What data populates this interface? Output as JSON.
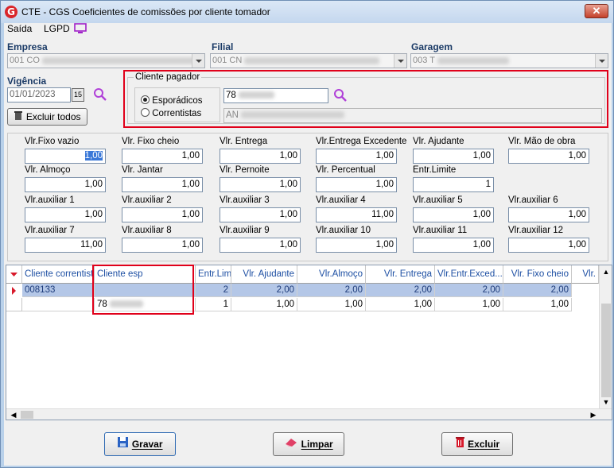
{
  "window": {
    "title": "CTE - CGS Coeficientes de comissões por cliente tomador",
    "icon": "app-logo-icon",
    "close": "✕"
  },
  "menu": {
    "saida": "Saída",
    "lgpd": "LGPD"
  },
  "empresa": {
    "label": "Empresa",
    "value": "001 CO"
  },
  "filial": {
    "label": "Filial",
    "value": "001 CN"
  },
  "garagem": {
    "label": "Garagem",
    "value": "003 T"
  },
  "vigencia": {
    "label": "Vigência",
    "value": "01/01/2023"
  },
  "excluir_todos": "Excluir todos",
  "cliente_pagador": {
    "legend": "Cliente pagador",
    "opt1": "Esporádicos",
    "opt2": "Correntistas",
    "code": "78",
    "name": "AN"
  },
  "fields": [
    {
      "label": "Vlr.Fixo vazio",
      "value": "1,00"
    },
    {
      "label": "Vlr. Fixo cheio",
      "value": "1,00"
    },
    {
      "label": "Vlr. Entrega",
      "value": "1,00"
    },
    {
      "label": "Vlr.Entrega Excedente",
      "value": "1,00"
    },
    {
      "label": "Vlr. Ajudante",
      "value": "1,00"
    },
    {
      "label": "Vlr. Mão de obra",
      "value": "1,00"
    },
    {
      "label": "Vlr. Almoço",
      "value": "1,00"
    },
    {
      "label": "Vlr. Jantar",
      "value": "1,00"
    },
    {
      "label": "Vlr. Pernoite",
      "value": "1,00"
    },
    {
      "label": "Vlr. Percentual",
      "value": "1,00"
    },
    {
      "label": "Entr.Limite",
      "value": "1"
    },
    {
      "label": "Vlr.auxiliar 1",
      "value": "1,00"
    },
    {
      "label": "Vlr.auxiliar 2",
      "value": "1,00"
    },
    {
      "label": "Vlr.auxiliar 3",
      "value": "1,00"
    },
    {
      "label": "Vlr.auxiliar 4",
      "value": "11,00"
    },
    {
      "label": "Vlr.auxiliar 5",
      "value": "1,00"
    },
    {
      "label": "Vlr.auxiliar 6",
      "value": "1,00"
    },
    {
      "label": "Vlr.auxiliar 7",
      "value": "11,00"
    },
    {
      "label": "Vlr.auxiliar 8",
      "value": "1,00"
    },
    {
      "label": "Vlr.auxiliar 9",
      "value": "1,00"
    },
    {
      "label": "Vlr.auxiliar 10",
      "value": "1,00"
    },
    {
      "label": "Vlr.auxiliar 11",
      "value": "1,00"
    },
    {
      "label": "Vlr.auxiliar 12",
      "value": "1,00"
    }
  ],
  "grid": {
    "columns": [
      "Cliente correntista",
      "Cliente esp",
      "Entr.Lim",
      "Vlr. Ajudante",
      "Vlr.Almoço",
      "Vlr. Entrega",
      "Vlr.Entr.Exced...",
      "Vlr. Fixo cheio",
      "Vlr."
    ],
    "rows": [
      [
        "008133",
        "",
        "2",
        "2,00",
        "2,00",
        "2,00",
        "2,00",
        "2,00"
      ],
      [
        "",
        "78",
        "1",
        "1,00",
        "1,00",
        "1,00",
        "1,00",
        "1,00"
      ]
    ]
  },
  "buttons": {
    "gravar": "Gravar",
    "limpar": "Limpar",
    "excluir": "Excluir"
  },
  "colors": {
    "highlight": "#e0001a",
    "label": "#1a3a66",
    "selected_row": "#b4c7e7"
  }
}
